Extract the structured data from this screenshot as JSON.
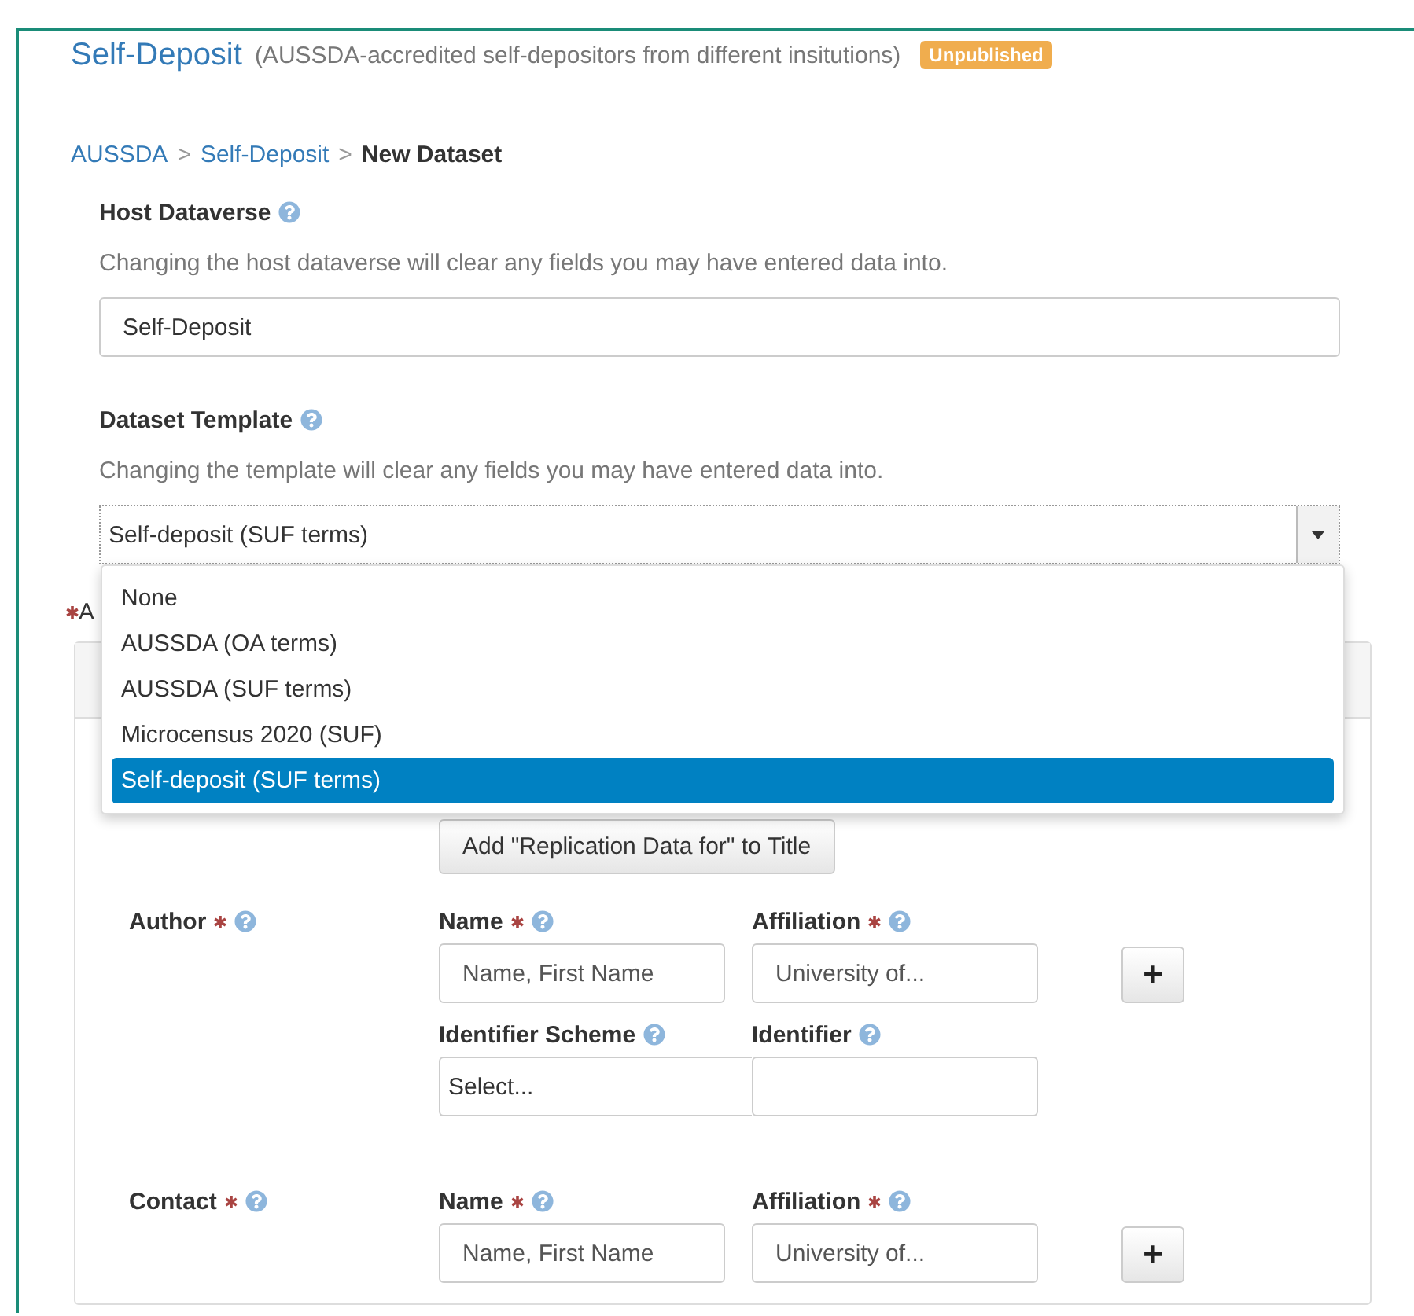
{
  "header": {
    "title": "Self-Deposit",
    "subtitle": "(AUSSDA-accredited self-depositors from different insitutions)",
    "badge": "Unpublished"
  },
  "breadcrumb": [
    {
      "label": "AUSSDA",
      "kind": "link"
    },
    {
      "label": ">",
      "kind": "separator"
    },
    {
      "label": "Self-Deposit",
      "kind": "link"
    },
    {
      "label": ">",
      "kind": "separator"
    },
    {
      "label": "New Dataset",
      "kind": "current"
    }
  ],
  "host": {
    "label": "Host Dataverse",
    "help": "Changing the host dataverse will clear any fields you may have entered data into.",
    "value": "Self-Deposit"
  },
  "template": {
    "label": "Dataset Template",
    "help": "Changing the template will clear any fields you may have entered data into.",
    "value": "Self-deposit (SUF terms)",
    "expanded": true,
    "options": [
      {
        "label": "None",
        "selected": false
      },
      {
        "label": "AUSSDA (OA terms)",
        "selected": false
      },
      {
        "label": "AUSSDA (SUF terms)",
        "selected": false
      },
      {
        "label": "Microcensus 2020 (SUF)",
        "selected": false
      },
      {
        "label": "Self-deposit (SUF terms)",
        "selected": true
      }
    ]
  },
  "section_label": {
    "text": "A",
    "required": true
  },
  "replication_button": "Add \"Replication Data for\" to Title",
  "fields": [
    {
      "label": "Author",
      "required": true,
      "add_button": "+",
      "rows": [
        [
          {
            "label": "Name",
            "required": true,
            "kind": "input",
            "placeholder": "Name, First Name"
          },
          {
            "label": "Affiliation",
            "required": true,
            "kind": "input",
            "placeholder": "University of..."
          }
        ],
        [
          {
            "label": "Identifier Scheme",
            "required": false,
            "kind": "select",
            "value": "Select..."
          },
          {
            "label": "Identifier",
            "required": false,
            "kind": "input"
          }
        ]
      ]
    },
    {
      "label": "Contact",
      "required": true,
      "add_button": "+",
      "rows": [
        [
          {
            "label": "Name",
            "required": true,
            "kind": "input",
            "placeholder": "Name, First Name"
          },
          {
            "label": "Affiliation",
            "required": true,
            "kind": "input",
            "placeholder": "University of..."
          }
        ]
      ]
    }
  ]
}
